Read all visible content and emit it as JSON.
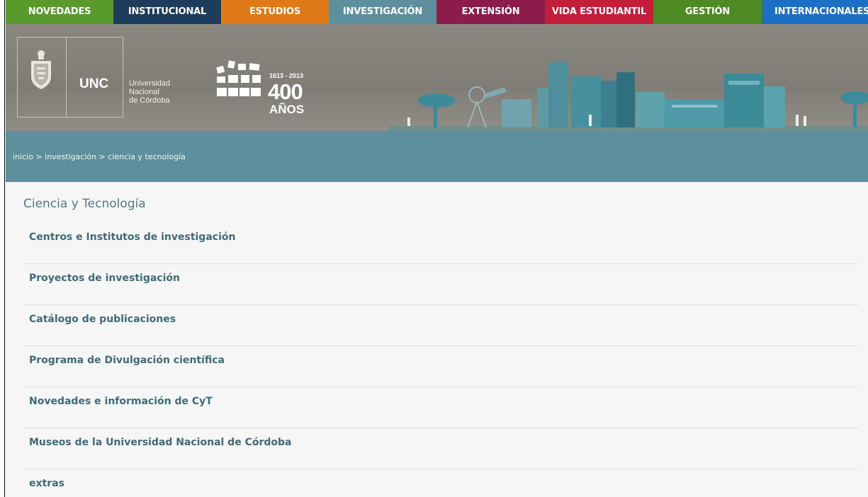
{
  "nav": {
    "tabs": [
      {
        "label": "NOVEDADES",
        "color": "#5a9a2c"
      },
      {
        "label": "INSTITUCIONAL",
        "color": "#1e3d5c"
      },
      {
        "label": "ESTUDIOS",
        "color": "#e07a19"
      },
      {
        "label": "INVESTIGACIÓN",
        "color": "#5e8f9c"
      },
      {
        "label": "EXTENSIÓN",
        "color": "#8c1c4b"
      },
      {
        "label": "VIDA ESTUDIANTIL",
        "color": "#c41d3a"
      },
      {
        "label": "GESTIÓN",
        "color": "#4d8a24"
      },
      {
        "label": "INTERNACIONALES",
        "color": "#1b6fc4"
      }
    ]
  },
  "header": {
    "acronym": "UNC",
    "name_line1": "Universidad",
    "name_line2": "Nacional",
    "name_line3": "de Córdoba",
    "years": "1613 - 2013",
    "anniversary_number": "400",
    "anniversary_word": "AÑOS"
  },
  "breadcrumb": {
    "items": [
      "inicio",
      "investigación",
      "ciencia y tecnología"
    ],
    "separator": ">"
  },
  "main": {
    "title": "Ciencia y Tecnología",
    "links": [
      "Centros e Institutos de investigación",
      "Proyectos de investigación",
      "Catálogo de publicaciones",
      "Programa de Divulgación científica",
      "Novedades e información de CyT",
      "Museos de la Universidad Nacional de Córdoba",
      "extras"
    ]
  }
}
